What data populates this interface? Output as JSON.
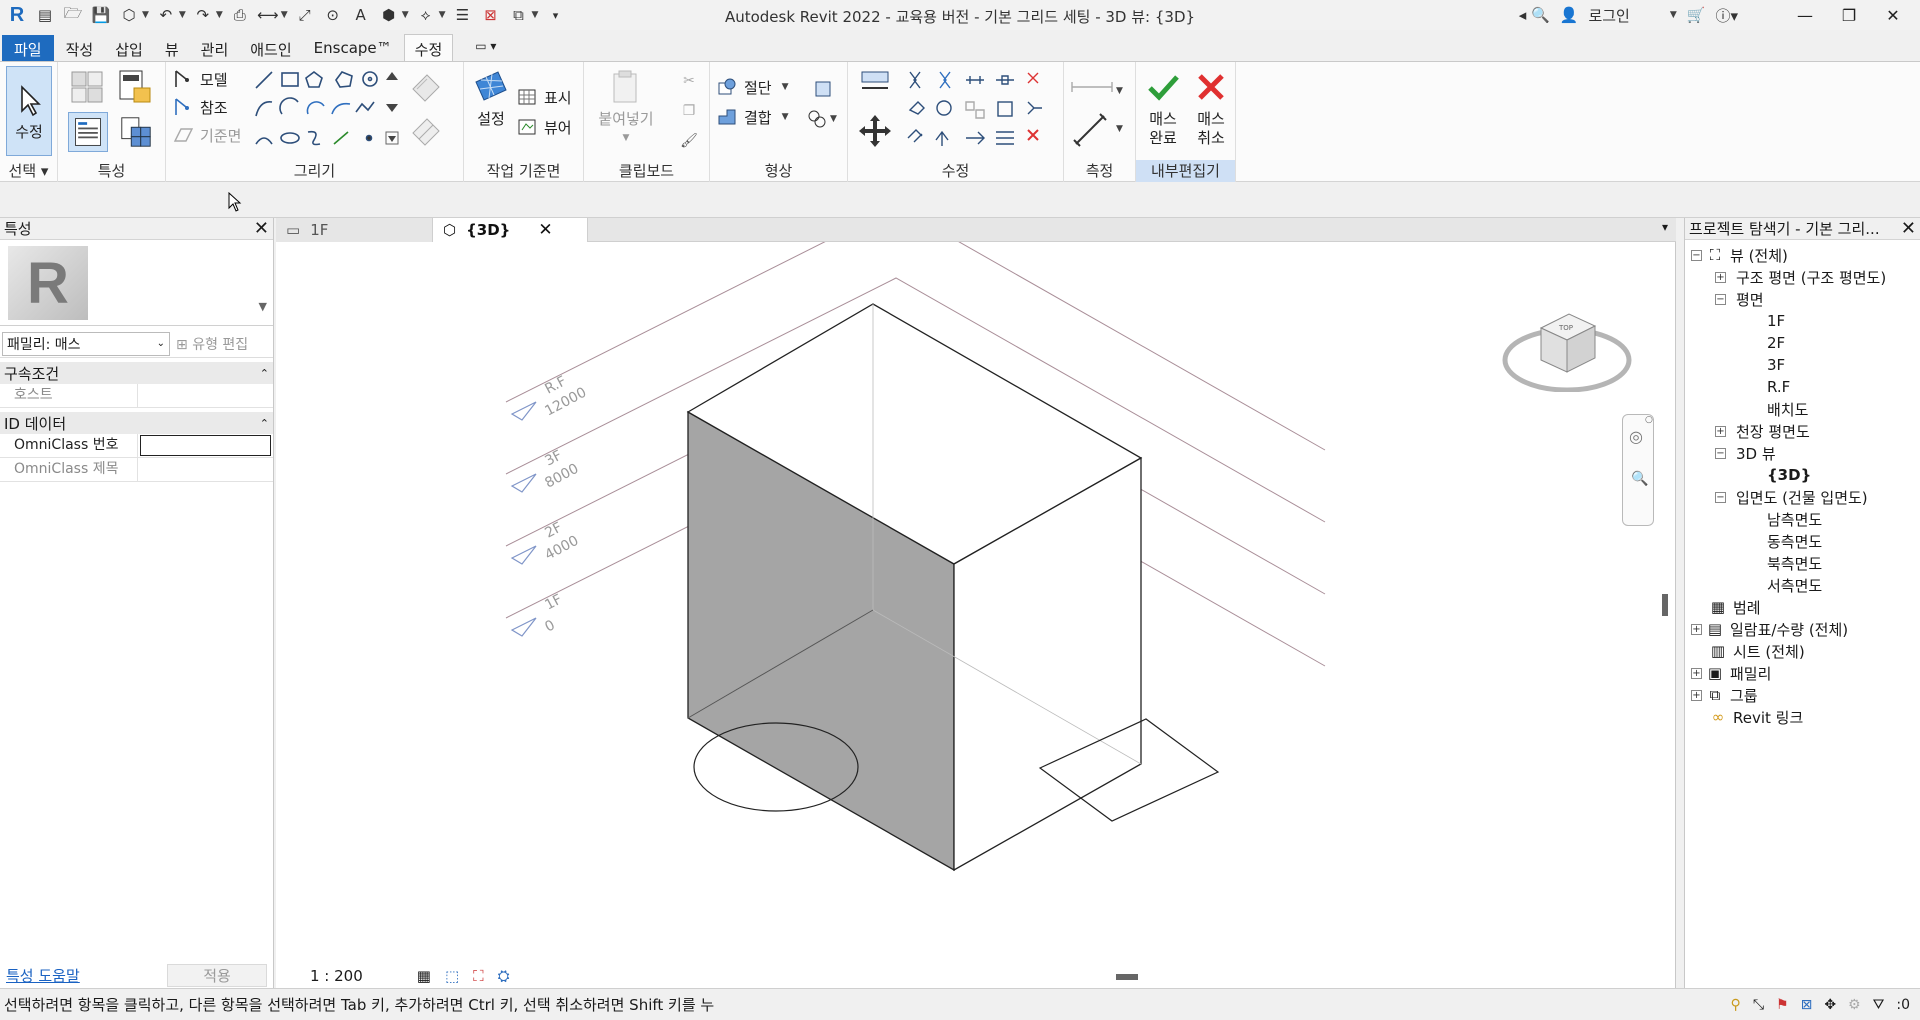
{
  "title_bar": {
    "app_title": "Autodesk Revit 2022 - 교육용 버전 - 기본 그리드 세팅 - 3D 뷰: {3D}",
    "login_label": "로그인"
  },
  "ribbon_tabs": [
    "파일",
    "작성",
    "삽입",
    "뷰",
    "관리",
    "애드인",
    "Enscape™",
    "수정"
  ],
  "active_tab": "수정",
  "ribbon": {
    "select": {
      "modify_label": "수정",
      "panel": "선택"
    },
    "properties": {
      "panel": "특성"
    },
    "draw": {
      "model_label": "모델",
      "ref_label": "참조",
      "workplane_label": "기준면",
      "panel": "그리기"
    },
    "workplane": {
      "set_label": "설정",
      "show_label": "표시",
      "viewer_label": "뷰어",
      "panel": "작업 기준면"
    },
    "clipboard": {
      "paste_label": "붙여넣기",
      "panel": "클립보드"
    },
    "geometry": {
      "cut_label": "절단",
      "join_label": "결합",
      "panel": "형상"
    },
    "modify": {
      "panel": "수정"
    },
    "measure": {
      "panel": "측정"
    },
    "inplace": {
      "finish_label_1": "매스",
      "finish_label_2": "완료",
      "cancel_label_1": "매스",
      "cancel_label_2": "취소",
      "panel": "내부편집기"
    }
  },
  "properties": {
    "title": "특성",
    "family_select": "패밀리: 매스",
    "type_edit": "유형 편집",
    "group_constraints": "구속조건",
    "host_label": "호스트",
    "group_identity": "ID 데이터",
    "omniclass_number": "OmniClass 번호",
    "omniclass_title": "OmniClass 제목",
    "help_link": "특성 도움말",
    "apply_button": "적용"
  },
  "view_tabs": [
    {
      "label": "1F"
    },
    {
      "label": "{3D}"
    }
  ],
  "levels": [
    {
      "name": "R.F",
      "elevation": "12000"
    },
    {
      "name": "3F",
      "elevation": "8000"
    },
    {
      "name": "2F",
      "elevation": "4000"
    },
    {
      "name": "1F",
      "elevation": "0"
    }
  ],
  "view_scale": "1 : 200",
  "browser": {
    "title": "프로젝트 탐색기 - 기본 그리...",
    "items": [
      {
        "label": "뷰 (전체)"
      },
      {
        "label": "구조 평면 (구조 평면도)"
      },
      {
        "label": "평면"
      },
      {
        "label": "1F"
      },
      {
        "label": "2F"
      },
      {
        "label": "3F"
      },
      {
        "label": "R.F"
      },
      {
        "label": "배치도"
      },
      {
        "label": "천장 평면도"
      },
      {
        "label": "3D 뷰"
      },
      {
        "label": "{3D}"
      },
      {
        "label": "입면도 (건물 입면도)"
      },
      {
        "label": "남측면도"
      },
      {
        "label": "동측면도"
      },
      {
        "label": "북측면도"
      },
      {
        "label": "서측면도"
      },
      {
        "label": "범례"
      },
      {
        "label": "일람표/수량 (전체)"
      },
      {
        "label": "시트 (전체)"
      },
      {
        "label": "패밀리"
      },
      {
        "label": "그룹"
      },
      {
        "label": "Revit 링크"
      }
    ]
  },
  "status_bar": {
    "message": "선택하려면 항목을 클릭하고, 다른 항목을 선택하려면 Tab 키, 추가하려면 Ctrl 키, 선택 취소하려면 Shift 키를 누",
    "filter_count": ":0"
  },
  "colors": {
    "file_tab": "#1e6bbf",
    "level_line": "#8a6f7a",
    "level_marker": "#7f95c8",
    "mass_face": "#a5a5a5",
    "finish_check": "#2e9e3a",
    "cancel_x": "#e03030"
  }
}
